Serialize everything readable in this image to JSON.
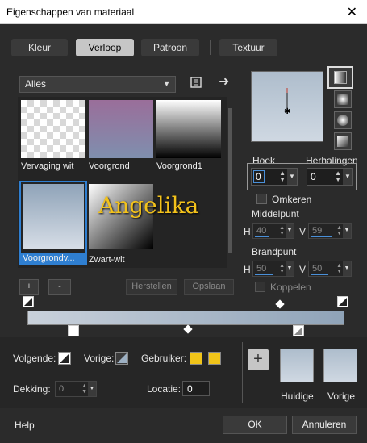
{
  "window": {
    "title": "Eigenschappen van materiaal",
    "close_glyph": "✕"
  },
  "tabs": [
    {
      "label": "Kleur",
      "active": false
    },
    {
      "label": "Verloop",
      "active": true
    },
    {
      "label": "Patroon",
      "active": false
    },
    {
      "label": "Textuur",
      "active": false
    }
  ],
  "library": {
    "category": "Alles",
    "category_caret": "▼",
    "book_icon": "book-icon",
    "next_icon": "arrow-right-icon",
    "next_glyph": "➜",
    "items": [
      {
        "label": "Vervaging wit",
        "selected": false
      },
      {
        "label": "Voorgrond",
        "selected": false
      },
      {
        "label": "Voorgrond1",
        "selected": false
      },
      {
        "label": "Voorgrondv...",
        "selected": true
      },
      {
        "label": "Zwart-wit",
        "selected": false
      }
    ],
    "add_label": "+",
    "remove_label": "-",
    "reset_label": "Herstellen",
    "save_label": "Opslaan"
  },
  "watermark": "Angelika",
  "gradient_settings": {
    "angle_label": "Hoek",
    "angle_value": "0",
    "repeats_label": "Herhalingen",
    "repeats_value": "0",
    "invert_label": "Omkeren",
    "midpoint_label": "Middelpunt",
    "midpoint_h_label": "H",
    "midpoint_h": "40",
    "midpoint_v_label": "V",
    "midpoint_v": "59",
    "focal_label": "Brandpunt",
    "focal_h_label": "H",
    "focal_h": "50",
    "focal_v_label": "V",
    "focal_v": "50",
    "link_label": "Koppelen",
    "spin_up": "▲",
    "spin_down": "▼"
  },
  "editor": {
    "foreground_label": "Volgende:",
    "background_label": "Vorige:",
    "user_label": "Gebruiker:",
    "user_color": "#f0c419",
    "opacity_label": "Dekking:",
    "opacity_value": "0",
    "location_label": "Locatie:",
    "location_value": "0",
    "plus_label": "+",
    "current_label": "Huidige",
    "previous_label": "Vorige",
    "gradient_start": "#c9d1db",
    "gradient_end": "#8fa3b8"
  },
  "footer": {
    "help_label": "Help",
    "ok_label": "OK",
    "cancel_label": "Annuleren"
  }
}
